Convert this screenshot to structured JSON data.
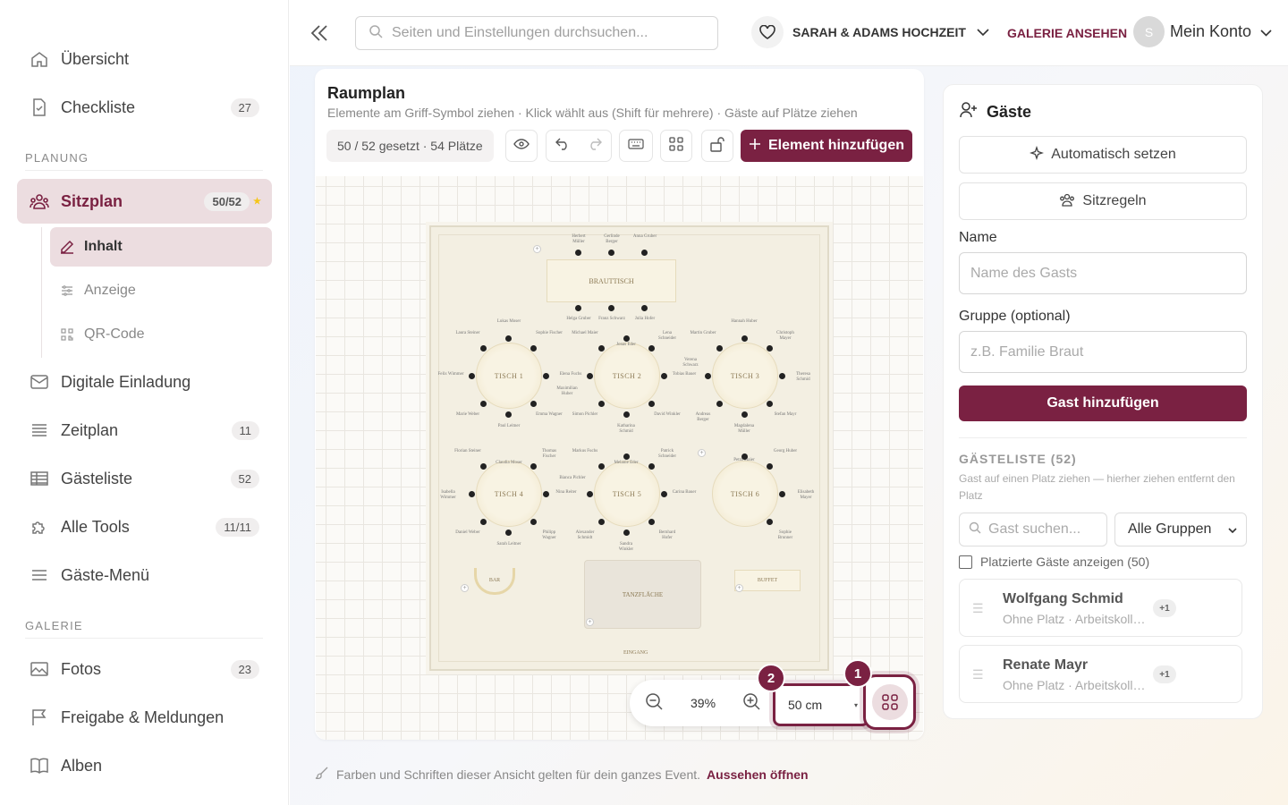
{
  "sidebar": {
    "items": [
      {
        "label": "Übersicht",
        "icon": "home-icon"
      },
      {
        "label": "Checkliste",
        "icon": "document-icon",
        "badge": "27"
      },
      {
        "label": "Sitzplan",
        "icon": "people-icon",
        "badge": "50/52"
      },
      {
        "label": "Digitale Einladung",
        "icon": "mail-icon"
      },
      {
        "label": "Zeitplan",
        "icon": "list-icon",
        "badge": "11"
      },
      {
        "label": "Gästeliste",
        "icon": "table-icon",
        "badge": "52"
      },
      {
        "label": "Alle Tools",
        "icon": "puzzle-icon",
        "badge": "11/11"
      },
      {
        "label": "Gäste-Menü",
        "icon": "menu-icon"
      },
      {
        "label": "Fotos",
        "icon": "image-icon",
        "badge": "23"
      },
      {
        "label": "Freigabe & Meldungen",
        "icon": "flag-icon"
      },
      {
        "label": "Alben",
        "icon": "book-icon"
      }
    ],
    "sections": {
      "planning": "PLANUNG",
      "gallery": "GALERIE"
    },
    "subitems": [
      {
        "label": "Inhalt",
        "icon": "edit-icon"
      },
      {
        "label": "Anzeige",
        "icon": "sliders-icon"
      },
      {
        "label": "QR-Code",
        "icon": "qr-icon"
      }
    ]
  },
  "topbar": {
    "search_placeholder": "Seiten und Einstellungen durchsuchen...",
    "event_name": "SARAH & ADAMS HOCHZEIT",
    "gallery_link": "GALERIE ANSEHEN",
    "avatar_initial": "S",
    "account_label": "Mein Konto"
  },
  "room": {
    "title": "Raumplan",
    "subtitle": "Elemente am Griff-Symbol ziehen · Klick wählt aus (Shift für mehrere) · Gäste auf Plätze ziehen",
    "count": "50 / 52 gesetzt · 54 Plätze",
    "add_element": "Element hinzufügen",
    "head_table": "BRAUTTISCH",
    "tables": [
      "TISCH 1",
      "TISCH 2",
      "TISCH 3",
      "TISCH 4",
      "TISCH 5",
      "TISCH 6"
    ],
    "bar": "BAR",
    "buffet": "BUFFET",
    "dance_floor": "TANZFLÄCHE",
    "entrance": "EINGANG",
    "head_top": [
      "Herbert Müller",
      "Gerlinde Berger",
      "Anna Gruber"
    ],
    "head_bottom": [
      "Helga Gruber",
      "Franz Schwarz",
      "Julia Hofer"
    ],
    "t1": [
      "Lukas Moser",
      "Laura Steiner",
      "Sophie Fischer",
      "Felix Wimmer",
      "Elena Fuchs",
      "Marie Weber",
      "Emma Wagner",
      "Paul Leitner"
    ],
    "t2": [
      "Michael Maier",
      "Jonas Eder",
      "Lena Schneider",
      "Maximilian Huber",
      "Tobias Bauer",
      "Simon Pichler",
      "David Winkler",
      "Katharina Schmid"
    ],
    "t3": [
      "Hannah Huber",
      "Martin Gruber",
      "Christoph Mayer",
      "Verena Schwarz",
      "Theresa Schmid",
      "Andreas Berger",
      "Stefan Mayr",
      "Magdalena Müller"
    ],
    "t4": [
      "Florian Steiner",
      "Claudia Moser",
      "Thomas Fischer",
      "Isabella Wimmer",
      "Nina Reiter",
      "Daniel Weber",
      "Philipp Wagner",
      "Sarah Leitner"
    ],
    "t5": [
      "Markus Fuchs",
      "Melanie Eder",
      "Patrick Schneider",
      "Bianca Pichler",
      "Carina Bauer",
      "Alexander Schmidt",
      "Bernhard Hofer",
      "Sandra Winkler"
    ],
    "t6": [
      "Petra Maier",
      "Georg Huber",
      "Elisabeth Mayer",
      "Sophie Brunner"
    ]
  },
  "zoom": {
    "value": "39%",
    "grid_size": "50 cm",
    "step1": "1",
    "step2": "2"
  },
  "footer": {
    "note": "Farben und Schriften dieser Ansicht gelten für dein ganzes Event.",
    "link": "Aussehen öffnen"
  },
  "guests": {
    "title": "Gäste",
    "auto_assign": "Automatisch setzen",
    "rules": "Sitzregeln",
    "name_label": "Name",
    "name_placeholder": "Name des Gasts",
    "group_label": "Gruppe (optional)",
    "group_placeholder": "z.B. Familie Braut",
    "add_button": "Gast hinzufügen",
    "list_title": "GÄSTELISTE (52)",
    "list_hint": "Gast auf einen Platz ziehen — hierher ziehen entfernt den Platz",
    "search_placeholder": "Gast suchen...",
    "group_filter": "Alle Gruppen",
    "show_placed": "Platzierte Gäste anzeigen (50)",
    "cards": [
      {
        "name": "Wolfgang Schmid",
        "meta": "Ohne Platz · Arbeitskollegen",
        "badge": "+1"
      },
      {
        "name": "Renate Mayr",
        "meta": "Ohne Platz · Arbeitskollegen",
        "badge": "+1"
      }
    ]
  },
  "colors": {
    "accent": "#7a2142",
    "accent_soft": "#ecdde0"
  }
}
